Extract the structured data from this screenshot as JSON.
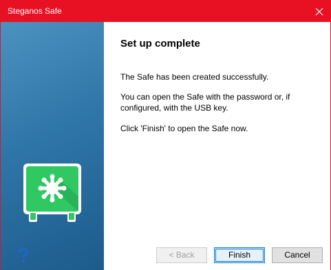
{
  "window": {
    "title": "Steganos Safe",
    "accent_color": "#e81123"
  },
  "sidebar": {
    "gradient_colors": [
      "#4c92c0",
      "#1c5b8c"
    ],
    "safe_icon_color": "#2fc863",
    "help_icon": "question-mark-icon"
  },
  "content": {
    "heading": "Set up complete",
    "paragraph1": "The Safe has been created successfully.",
    "paragraph2": "You can open the Safe with the password or, if configured, with the USB key.",
    "paragraph3": "Click 'Finish' to open the Safe now."
  },
  "buttons": {
    "back": "< Back",
    "finish": "Finish",
    "cancel": "Cancel"
  }
}
